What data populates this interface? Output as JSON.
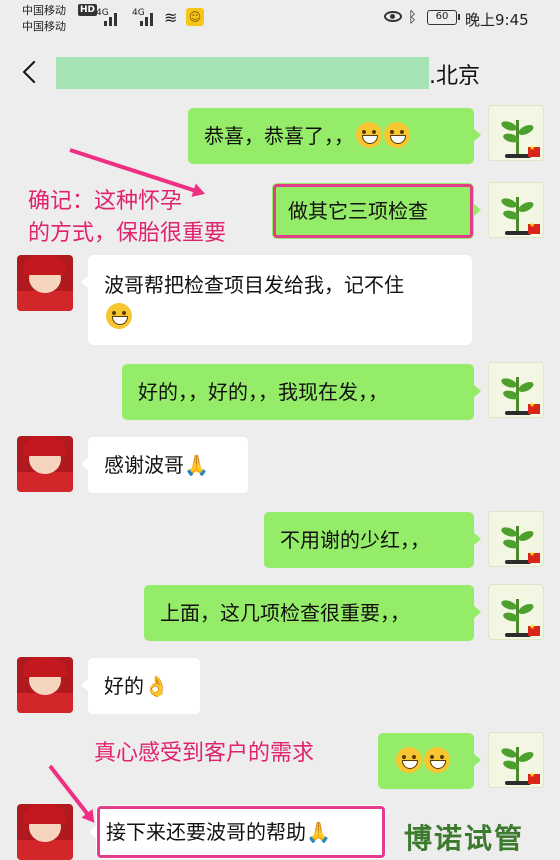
{
  "status_bar": {
    "carrier1": "中国移动",
    "carrier2": "中国移动",
    "hd_badge": "HD",
    "signal1": "4G",
    "signal2": "4G",
    "battery": "60",
    "time": "晚上9:45"
  },
  "header": {
    "title": ".北京"
  },
  "messages": [
    {
      "side": "me",
      "text": "恭喜，恭喜了，，"
    },
    {
      "side": "me",
      "text": "做其它三项检查"
    },
    {
      "side": "other",
      "text": "波哥帮把检查项目发给我，记不住"
    },
    {
      "side": "me",
      "text": "好的，，好的，，我现在发，，"
    },
    {
      "side": "other",
      "text": "感谢波哥"
    },
    {
      "side": "me",
      "text": "不用谢的少红，，"
    },
    {
      "side": "me",
      "text": "上面，这几项检查很重要，，"
    },
    {
      "side": "other",
      "text": "好的"
    },
    {
      "side": "me",
      "text": ""
    },
    {
      "side": "other",
      "text": "接下来还要波哥的帮助"
    }
  ],
  "annotations": {
    "note1_line1": "确记：这种怀孕",
    "note1_line2": "的方式，保胎很重要",
    "note2": "真心感受到客户的需求"
  },
  "watermark": "博诺试管",
  "colors": {
    "my_bubble": "#95ec69",
    "other_bubble": "#ffffff",
    "background": "#ededed",
    "annotation": "#e0226f"
  }
}
